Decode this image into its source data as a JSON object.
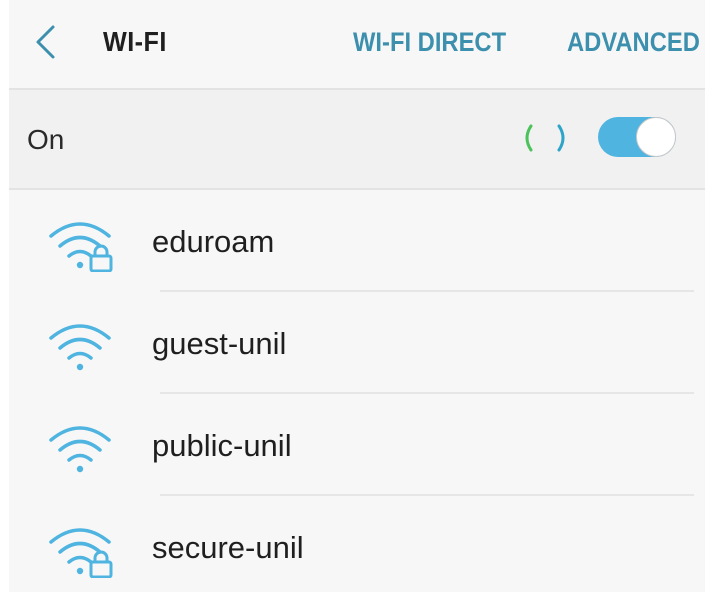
{
  "header": {
    "title": "WI-FI",
    "wifi_direct_label": "WI-FI DIRECT",
    "advanced_label": "ADVANCED"
  },
  "status": {
    "label": "On",
    "enabled": true
  },
  "colors": {
    "accent": "#4fb4e0",
    "link": "#3d8fae",
    "spinner_green": "#4cc35a",
    "spinner_blue": "#2ea4c9"
  },
  "networks": [
    {
      "name": "eduroam",
      "secured": true,
      "icon": "wifi-lock-icon"
    },
    {
      "name": "guest-unil",
      "secured": false,
      "icon": "wifi-icon"
    },
    {
      "name": "public-unil",
      "secured": false,
      "icon": "wifi-icon"
    },
    {
      "name": "secure-unil",
      "secured": true,
      "icon": "wifi-lock-icon"
    }
  ]
}
